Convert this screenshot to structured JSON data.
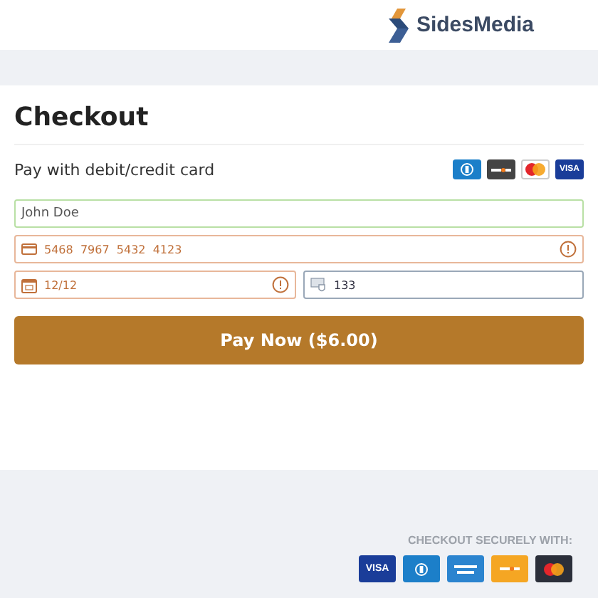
{
  "logo": {
    "name": "SidesMedia"
  },
  "title": "Checkout",
  "pay_label": "Pay with debit/credit card",
  "top_cards": [
    {
      "kind": "diners"
    },
    {
      "kind": "discover"
    },
    {
      "kind": "mastercard"
    },
    {
      "kind": "visa",
      "label": "VISA"
    }
  ],
  "fields": [
    {
      "kind": "name",
      "value": "John Doe",
      "valid": true,
      "error": false
    },
    {
      "kind": "card",
      "value": "5468  7967  5432  4123",
      "valid": false,
      "error": true
    },
    {
      "kind": "expiry",
      "value": "12/12",
      "valid": false,
      "error": true
    },
    {
      "kind": "cvv",
      "value": "133",
      "valid": false,
      "error": false
    }
  ],
  "pay_button": "Pay Now ($6.00)",
  "secure_label": "CHECKOUT SECURELY WITH:",
  "bottom_cards": [
    {
      "kind": "visa",
      "label": "VISA"
    },
    {
      "kind": "diners"
    },
    {
      "kind": "amex"
    },
    {
      "kind": "discover"
    },
    {
      "kind": "mastercard"
    }
  ]
}
